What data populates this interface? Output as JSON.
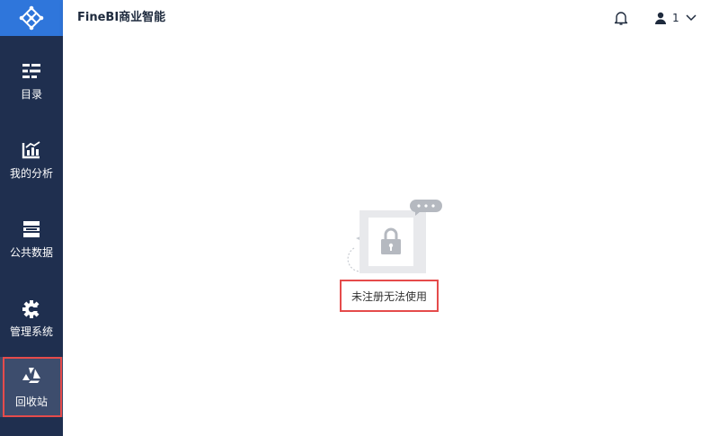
{
  "header": {
    "app_title": "FineBI商业智能",
    "user_name": "1"
  },
  "sidebar": {
    "items": [
      {
        "label": "目录",
        "icon": "catalog-icon"
      },
      {
        "label": "我的分析",
        "icon": "analysis-icon"
      },
      {
        "label": "公共数据",
        "icon": "database-icon"
      },
      {
        "label": "管理系统",
        "icon": "gear-icon"
      },
      {
        "label": "回收站",
        "icon": "recycle-icon",
        "active": true
      }
    ]
  },
  "main": {
    "message": "未注册无法使用",
    "illustration_icon": "lock-icon"
  },
  "colors": {
    "sidebar_bg": "#1f2f4f",
    "logo_bg": "#2f76db",
    "highlight_border": "#e54b4b"
  }
}
